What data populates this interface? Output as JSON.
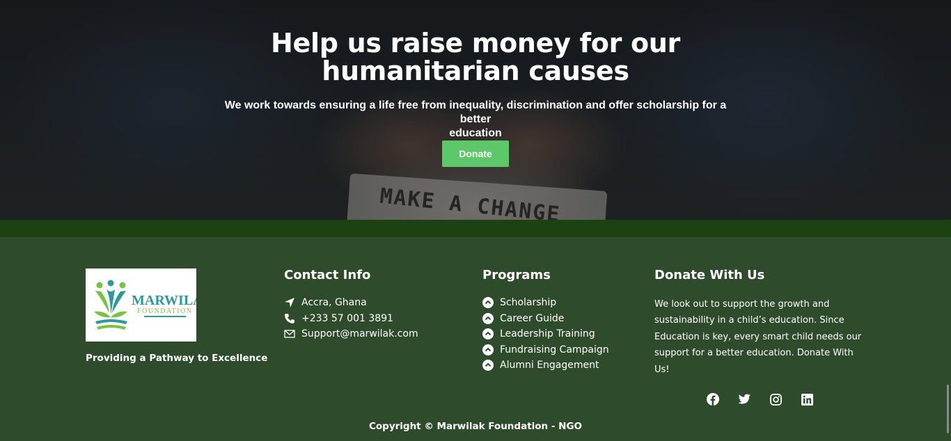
{
  "hero": {
    "title_line1": "Help us raise money for our",
    "title_line2": "humanitarian causes",
    "subtitle_line1": "We work towards ensuring a life free from inequality, discrimination and offer scholarship for a better",
    "subtitle_line2": "education",
    "donate_label": "Donate",
    "photo_note_text": "MAKE A CHANGE"
  },
  "footer": {
    "logo": {
      "name": "MARWILAK",
      "sub": "FOUNDATION"
    },
    "tagline": "Providing a Pathway to Excellence",
    "contact": {
      "title": "Contact Info",
      "items": [
        {
          "icon": "location-arrow-icon",
          "text": "Accra, Ghana"
        },
        {
          "icon": "phone-icon",
          "text": "+233 57 001 3891"
        },
        {
          "icon": "envelope-icon",
          "text": "Support@marwilak.com"
        }
      ]
    },
    "programs": {
      "title": "Programs",
      "items": [
        {
          "icon": "chevron-up-circle-icon",
          "text": "Scholarship"
        },
        {
          "icon": "chevron-up-circle-icon",
          "text": "Career Guide"
        },
        {
          "icon": "chevron-up-circle-icon",
          "text": "Leadership Training"
        },
        {
          "icon": "chevron-up-circle-icon",
          "text": "Fundraising Campaign"
        },
        {
          "icon": "chevron-up-circle-icon",
          "text": "Alumni Engagement"
        }
      ]
    },
    "donate": {
      "title": "Donate With Us",
      "text": "We look out to support the growth and sustainability in a child’s education. Since Education is key, every smart child needs our support for a better education. Donate With Us!"
    },
    "socials": [
      "facebook-icon",
      "twitter-icon",
      "instagram-icon",
      "linkedin-icon"
    ],
    "copyright": "Copyright © Marwilak Foundation - NGO"
  },
  "colors": {
    "footer_bg": "#2e4b2c",
    "band": "#1c4213",
    "button": "#5dc86a",
    "logo_teal": "#2a9a9a",
    "logo_green": "#7cc242"
  }
}
